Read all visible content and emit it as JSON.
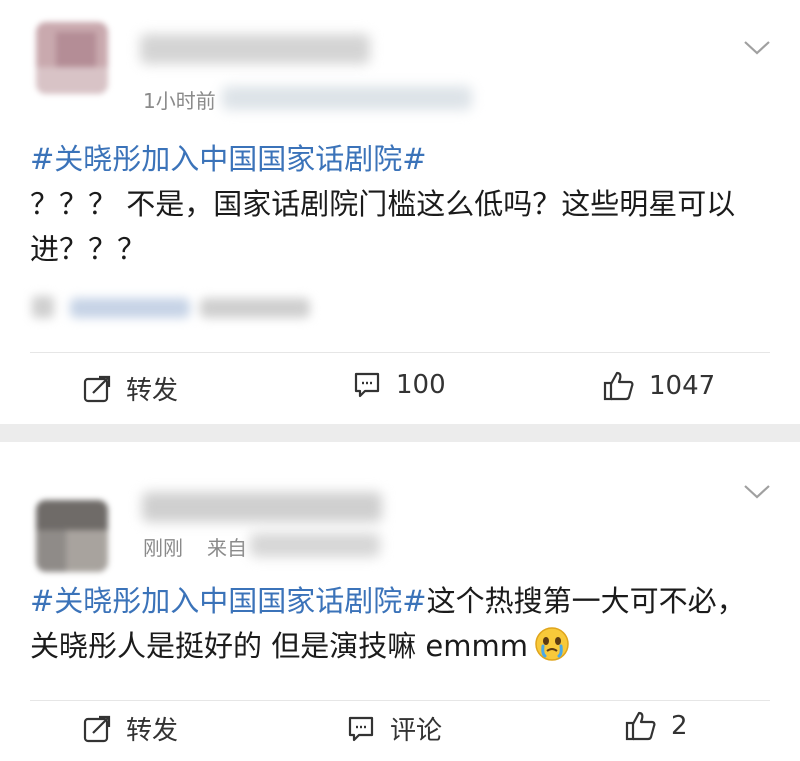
{
  "posts": [
    {
      "meta_time": "1小时前",
      "hashtag": "#关晓彤加入中国国家话剧院#",
      "body": "？？？ 不是，国家话剧院门槛这么低吗？这些明星可以进？？？",
      "actions": {
        "repost_label": "转发",
        "comment_count": "100",
        "like_count": "1047"
      }
    },
    {
      "meta_time": "刚刚",
      "meta_source": "来自",
      "hashtag": "#关晓彤加入中国国家话剧院#",
      "body": "这个热搜第一大可不必，关晓彤人是挺好的 但是演技嘛 emmm",
      "emoji": "crying-emoji",
      "actions": {
        "repost_label": "转发",
        "comment_label": "评论",
        "like_count": "2"
      }
    }
  ],
  "colors": {
    "hashtag": "#3b73b9",
    "meta": "#8a8a8a",
    "background": "#ececec",
    "card": "#ffffff"
  }
}
